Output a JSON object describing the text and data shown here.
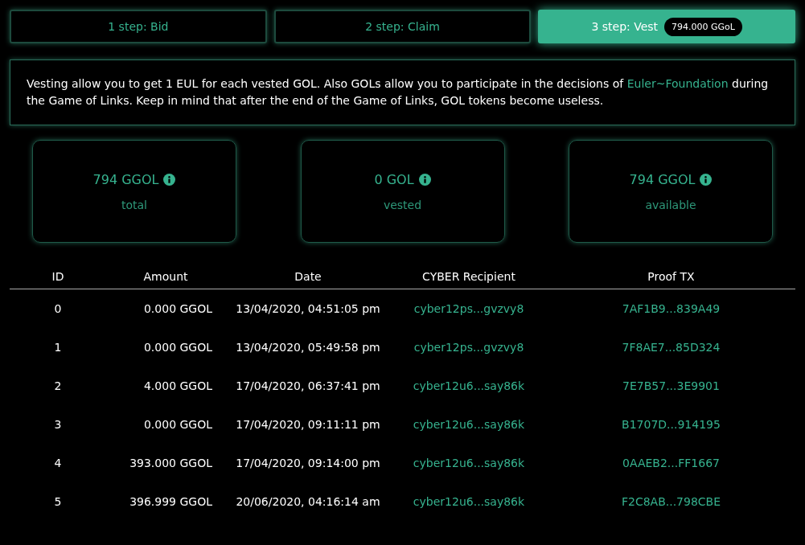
{
  "steps": [
    {
      "label": "1 step: Bid",
      "selected": false
    },
    {
      "label": "2 step: Claim",
      "selected": false
    },
    {
      "label": "3 step: Vest",
      "selected": true,
      "badge": "794.000 GGoL"
    }
  ],
  "notice": {
    "before": "Vesting allow you to get 1 EUL for each vested GOL. Also GOLs allow you to participate in the decisions of ",
    "link": "Euler~Foundation",
    "after": " during the Game of Links. Keep in mind that after the end of the Game of Links, GOL tokens become useless."
  },
  "stats": [
    {
      "value": "794 GGOL",
      "label": "total"
    },
    {
      "value": "0 GOL",
      "label": "vested"
    },
    {
      "value": "794 GGOL",
      "label": "available"
    }
  ],
  "table": {
    "columns": [
      "ID",
      "Amount",
      "Date",
      "CYBER Recipient",
      "Proof TX"
    ],
    "rows": [
      [
        "0",
        "0.000 GGOL",
        "13/04/2020, 04:51:05 pm",
        "cyber12ps...gvzvy8",
        "7AF1B9...839A49"
      ],
      [
        "1",
        "0.000 GGOL",
        "13/04/2020, 05:49:58 pm",
        "cyber12ps...gvzvy8",
        "7F8AE7...85D324"
      ],
      [
        "2",
        "4.000 GGOL",
        "17/04/2020, 06:37:41 pm",
        "cyber12u6...say86k",
        "7E7B57...3E9901"
      ],
      [
        "3",
        "0.000 GGOL",
        "17/04/2020, 09:11:11 pm",
        "cyber12u6...say86k",
        "B1707D...914195"
      ],
      [
        "4",
        "393.000 GGOL",
        "17/04/2020, 09:14:00 pm",
        "cyber12u6...say86k",
        "0AAEB2...FF1667"
      ],
      [
        "5",
        "396.999 GGOL",
        "20/06/2020, 04:16:14 am",
        "cyber12u6...say86k",
        "F2C8AB...798CBE"
      ]
    ]
  }
}
